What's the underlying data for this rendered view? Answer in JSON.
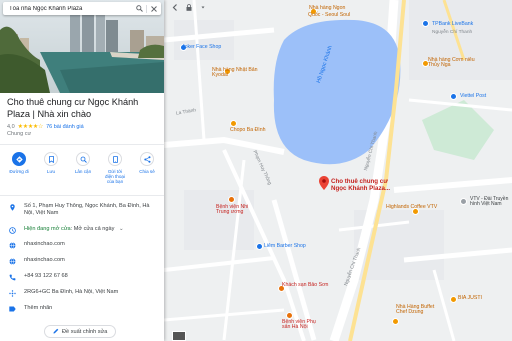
{
  "search": {
    "value": "Tòa nhà Ngọc Khánh Plaza"
  },
  "place": {
    "title": "Cho thuê chung cư Ngọc Khánh Plaza | Nhà xin chào",
    "rating": "4,0",
    "stars": "★★★★☆",
    "reviews": "76 bài đánh giá",
    "category": "Chung cư"
  },
  "actions": [
    {
      "label": "Đường đi",
      "icon": "directions-icon"
    },
    {
      "label": "Lưu",
      "icon": "bookmark-icon"
    },
    {
      "label": "Lân cận",
      "icon": "nearby-icon"
    },
    {
      "label": "Gửi tới điện thoại của bạn",
      "icon": "send-to-phone-icon"
    },
    {
      "label": "Chia sẻ",
      "icon": "share-icon"
    }
  ],
  "info": {
    "address": "Số 1, Phạm Huy Thông, Ngọc Khánh, Ba Đình, Hà Nội, Việt Nam",
    "hours_status": "Hiện đang mở cửa",
    "hours_text": "Mở cửa cả ngày",
    "website_1": "nhaxinchao.com",
    "website_2": "nhaxinchao.com",
    "phone": "+84 93 122 67 68",
    "plus_code": "2RG6+GC Ba Đình, Hà Nội, Việt Nam",
    "add_label": "Thêm nhãn"
  },
  "suggest_edit": "Đề xuất chỉnh sửa",
  "map": {
    "pin_label": "Cho thuê chung cư Ngọc Khánh Plaza...",
    "lake_name": "Hồ Ngọc Khánh",
    "labels": {
      "nha_hang_ngon": "Nhà hàng Ngon",
      "quoc_seoul": "Quốc - Seoul Soul",
      "tpbank": "TPBank LiveBank",
      "nguyen_chi_thanh_1": "Nguyễn Chí Thanh",
      "joker": "Joker Face Shop",
      "nha_hang_nhat_ban": "Nhà hàng Nhật Bản Kyodai",
      "nha_hang_com": "Nhà hàng Cơm niêu Thủy Nga",
      "viettel": "Viettel Post",
      "la_thanh": "La Thành",
      "chopo": "Chopo Ba Đình",
      "pham_huy_thong": "Phạm Huy Thông",
      "nguyen_chi_thanh_2": "Nguyễn Chí Thanh",
      "nguyen_chi_thanh_3": "Nguyễn Chí Thanh",
      "benh_vien_nhi": "Bệnh viện Nhi Trung ương",
      "highlands": "Highlands Coffee VTV",
      "vtv": "VTV - Đài Truyền hình Việt Nam",
      "liem_barber": "Liêm Barber Shop",
      "khach_san": "Khách sạn Bảo Sơn",
      "benh_vien_phu_san": "Bệnh viện Phụ sản Hà Nội",
      "nha_hang_buffet": "Nhà Hàng Buffet Chef Dzung",
      "justi": "BIA JUSTI"
    }
  }
}
